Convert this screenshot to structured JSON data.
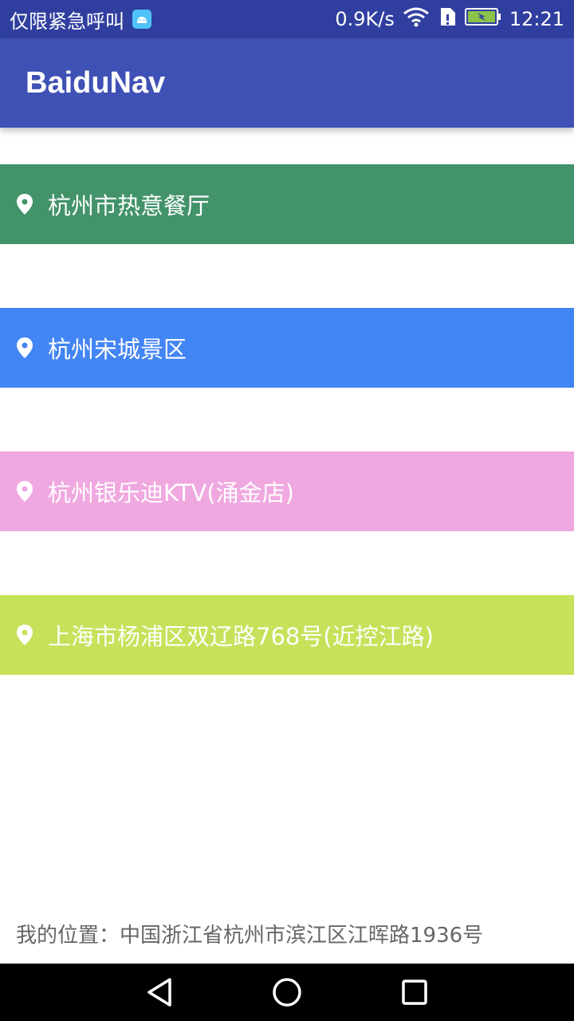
{
  "status_bar": {
    "notice": "仅限紧急呼叫",
    "speed": "0.9K/s",
    "time": "12:21",
    "icons": [
      "android-debug-icon",
      "wifi-icon",
      "sim-icon",
      "battery-charging-icon"
    ]
  },
  "app_bar": {
    "title": "BaiduNav"
  },
  "places": [
    {
      "label": "杭州市热意餐厅",
      "color": "#43936a"
    },
    {
      "label": "杭州宋城景区",
      "color": "#4285f4"
    },
    {
      "label": "杭州银乐迪KTV(涌金店)",
      "color": "#f0a8e0"
    },
    {
      "label": "上海市杨浦区双辽路768号(近控江路)",
      "color": "#c6e25a"
    }
  ],
  "my_location": {
    "text": "我的位置：中国浙江省杭州市滨江区江晖路1936号"
  },
  "nav_bar": {
    "icons": [
      "back-icon",
      "home-icon",
      "recents-icon"
    ]
  }
}
